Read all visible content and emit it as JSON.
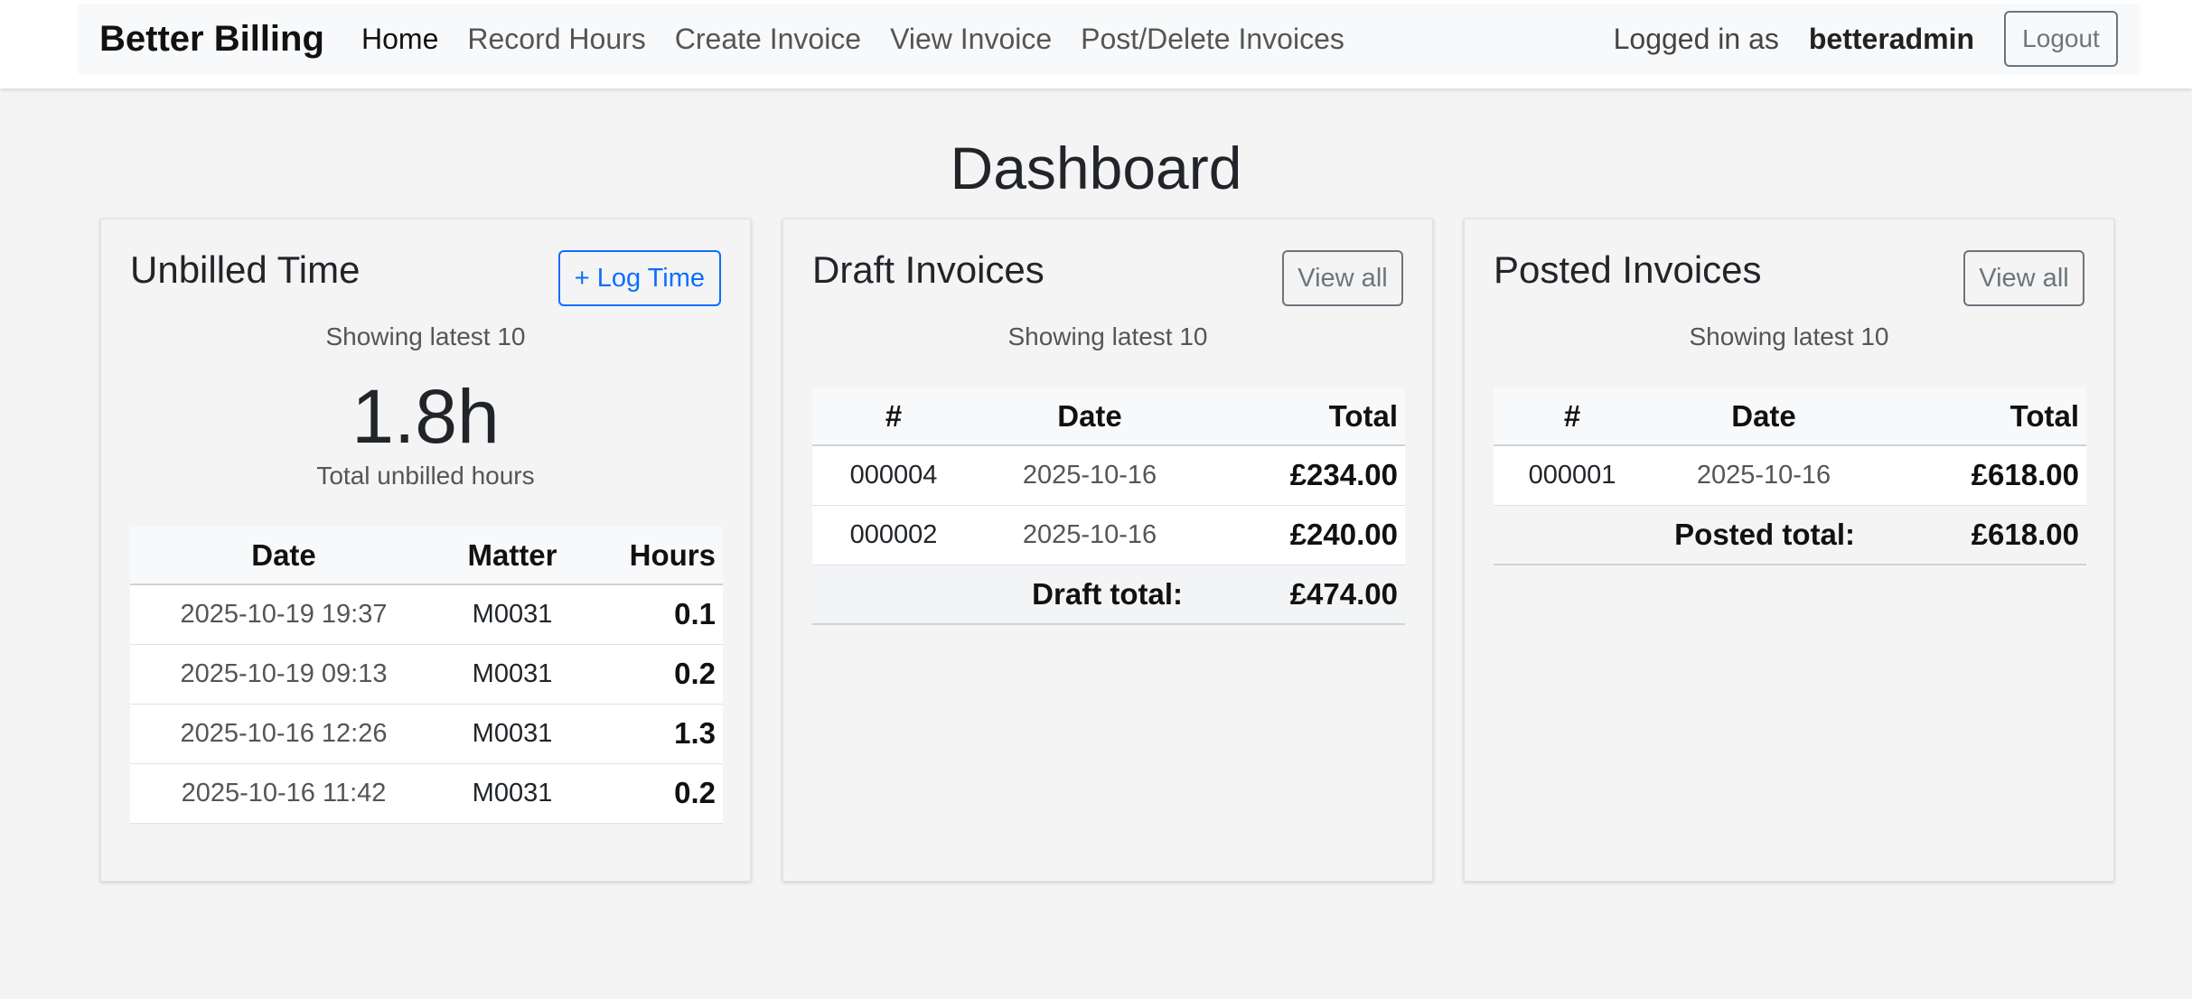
{
  "brand": "Better Billing",
  "nav": [
    {
      "label": "Home",
      "active": true
    },
    {
      "label": "Record Hours",
      "active": false
    },
    {
      "label": "Create Invoice",
      "active": false
    },
    {
      "label": "View Invoice",
      "active": false
    },
    {
      "label": "Post/Delete Invoices",
      "active": false
    }
  ],
  "user": {
    "logged_in_label": "Logged in as",
    "username": "betteradmin",
    "logout_label": "Logout"
  },
  "page_title": "Dashboard",
  "unbilled": {
    "title": "Unbilled Time",
    "button_label": "+ Log Time",
    "showing": "Showing latest 10",
    "total_hours": "1.8h",
    "total_caption": "Total unbilled hours",
    "columns": [
      "Date",
      "Matter",
      "Hours"
    ],
    "rows": [
      {
        "date": "2025-10-19 19:37",
        "matter": "M0031",
        "hours": "0.1"
      },
      {
        "date": "2025-10-19 09:13",
        "matter": "M0031",
        "hours": "0.2"
      },
      {
        "date": "2025-10-16 12:26",
        "matter": "M0031",
        "hours": "1.3"
      },
      {
        "date": "2025-10-16 11:42",
        "matter": "M0031",
        "hours": "0.2"
      }
    ]
  },
  "draft": {
    "title": "Draft Invoices",
    "button_label": "View all",
    "showing": "Showing latest 10",
    "columns": [
      "#",
      "Date",
      "Total"
    ],
    "rows": [
      {
        "num": "000004",
        "date": "2025-10-16",
        "total": "£234.00"
      },
      {
        "num": "000002",
        "date": "2025-10-16",
        "total": "£240.00"
      }
    ],
    "total_label": "Draft total:",
    "total_value": "£474.00"
  },
  "posted": {
    "title": "Posted Invoices",
    "button_label": "View all",
    "showing": "Showing latest 10",
    "columns": [
      "#",
      "Date",
      "Total"
    ],
    "rows": [
      {
        "num": "000001",
        "date": "2025-10-16",
        "total": "£618.00"
      }
    ],
    "total_label": "Posted total:",
    "total_value": "£618.00"
  }
}
